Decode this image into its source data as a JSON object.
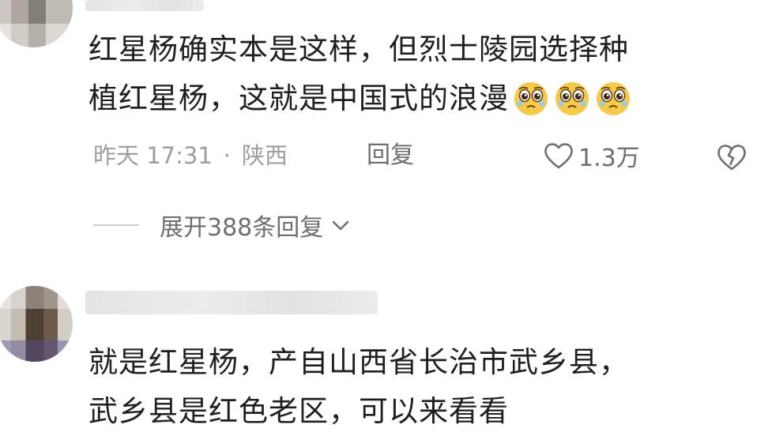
{
  "comments": [
    {
      "lines": [
        "红星杨确实本是这样，但烈士陵园选择种",
        "植红星杨，这就是中国式的浪漫"
      ],
      "emoji": [
        "pleading-face-icon",
        "pleading-face-icon",
        "pleading-face-icon"
      ],
      "time": "昨天 17:31",
      "separator": "·",
      "location": "陕西",
      "reply_label": "回复",
      "like_count": "1.3万",
      "expand_label": "展开388条回复"
    },
    {
      "lines": [
        "就是红星杨，产自山西省长治市武乡县，",
        "武乡县是红色老区，可以来看看"
      ]
    }
  ],
  "icons": {
    "like": "heart-icon",
    "dislike": "broken-heart-icon",
    "expand": "chevron-down-icon",
    "emoji": "pleading-face-icon"
  },
  "colors": {
    "text": "#1f1f1f",
    "meta": "#9e9e9e",
    "action": "#6e6e6e",
    "emoji_face": "#f7c948"
  }
}
